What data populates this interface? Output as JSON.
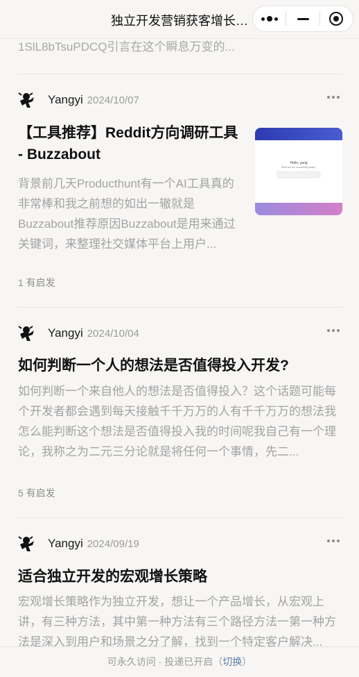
{
  "window": {
    "title": "独立开发营销获客增长实战"
  },
  "prev_snippet": "1SlL8bTsuPDCQ引言在这个瞬息万变的...",
  "articles": [
    {
      "author": "Yangyi",
      "date": "2024/10/07",
      "title": "【工具推荐】Reddit方向调研工具 - Buzzabout",
      "excerpt": "背景前几天Producthunt有一个AI工具真的非常棒和我之前想的如出一辙就是Buzzabout推荐原因Buzzabout是用来通过关键词，来整理社交媒体平台上用户...",
      "likes": "1 有启发",
      "thumbnail": {
        "heading": "Hello, yang",
        "sub": "What are you researching today?"
      }
    },
    {
      "author": "Yangyi",
      "date": "2024/10/04",
      "title": "如何判断一个人的想法是否值得投入开发?",
      "excerpt": "如何判断一个来自他人的想法是否值得投入？这个话题可能每个开发者都会遇到每天接触千千万万的人有千千万万的想法我怎么能判断这个想法是否值得投入我的时间呢我自己有一个理论，我称之为二元三分论就是将任何一个事情，先二...",
      "likes": "5 有启发"
    },
    {
      "author": "Yangyi",
      "date": "2024/09/19",
      "title": "适合独立开发的宏观增长策略",
      "excerpt": "宏观增长策略作为独立开发，想让一个产品增长，从宏观上讲，有三种方法，其中第一种方法有三个路径方法一第一种方法是深入到用户和场景之分了解，找到一个特定客户解决..."
    }
  ],
  "footer": {
    "text": "可永久访问 · 投递已开启（",
    "link": "切换",
    "close": "）"
  }
}
